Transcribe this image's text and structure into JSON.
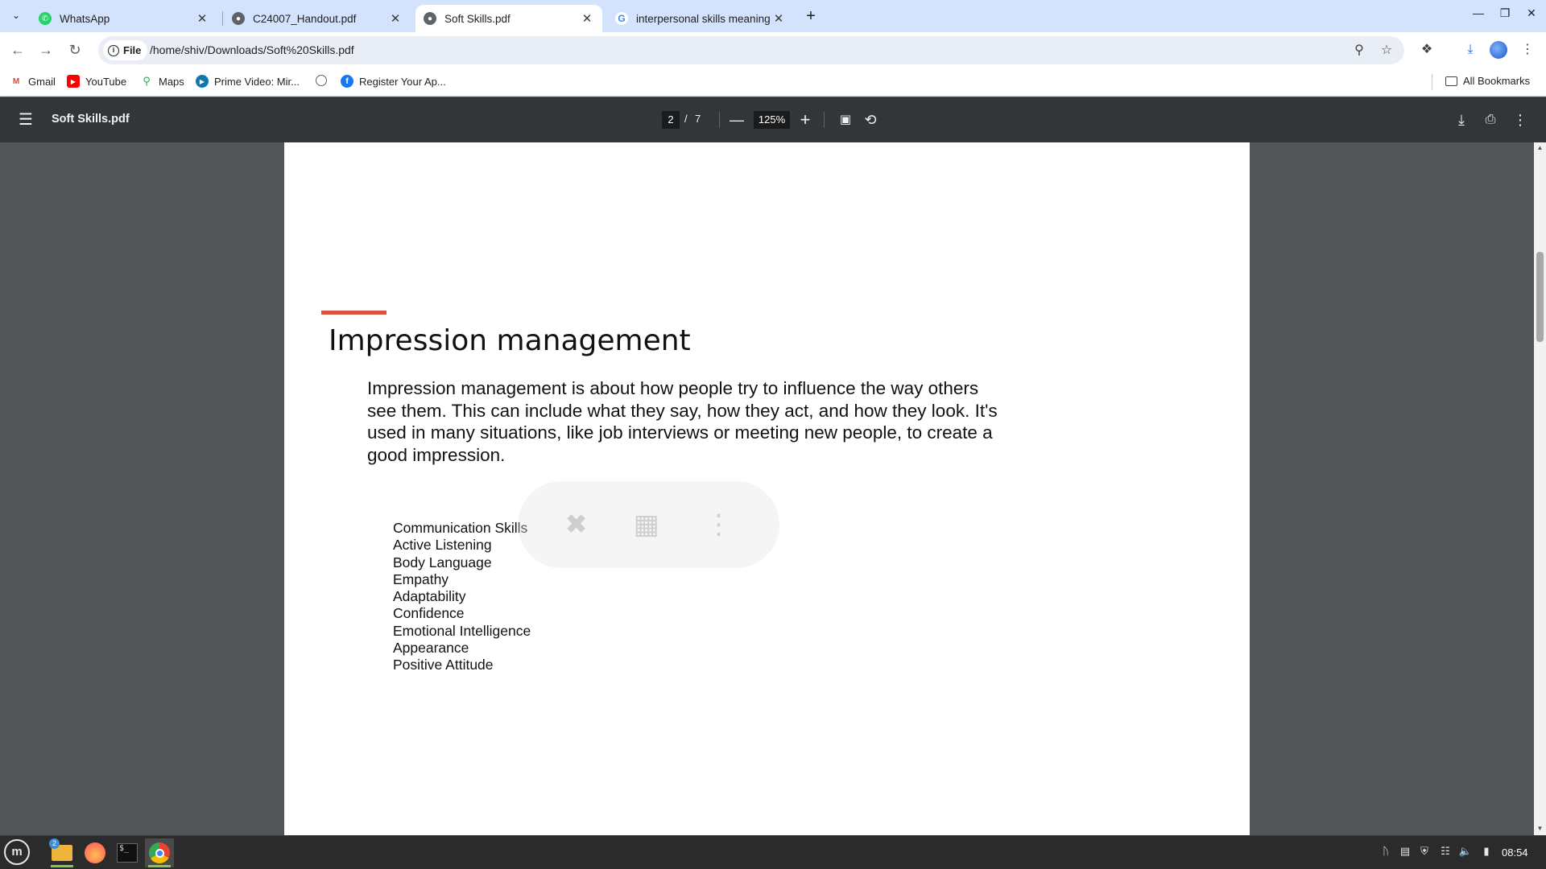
{
  "browser": {
    "tabs": [
      {
        "title": "WhatsApp",
        "active": false,
        "icon": "whatsapp-icon"
      },
      {
        "title": "C24007_Handout.pdf",
        "active": false,
        "icon": "globe-icon"
      },
      {
        "title": "Soft Skills.pdf",
        "active": true,
        "icon": "globe-icon"
      },
      {
        "title": "interpersonal skills meaning",
        "active": false,
        "icon": "google-icon"
      }
    ],
    "chip_label": "File",
    "url": "/home/shiv/Downloads/Soft%20Skills.pdf",
    "bookmarks": [
      {
        "label": "Gmail",
        "icon": "gmail-icon"
      },
      {
        "label": "YouTube",
        "icon": "youtube-icon"
      },
      {
        "label": "Maps",
        "icon": "maps-icon"
      },
      {
        "label": "Prime Video: Mir...",
        "icon": "prime-video-icon"
      },
      {
        "label": "",
        "icon": "globe-icon"
      },
      {
        "label": "Register Your Ap...",
        "icon": "facebook-icon"
      }
    ],
    "all_bookmarks_label": "All Bookmarks"
  },
  "pdf_viewer": {
    "title": "Soft Skills.pdf",
    "current_page": "2",
    "page_separator": "/",
    "total_pages": "7",
    "zoom": "125%"
  },
  "slide": {
    "title": "Impression management",
    "body": "Impression management is about how people try to influence the way others see them. This can include what they say, how they act, and how they look. It's used in many situations, like job interviews or meeting new people, to create a good impression.",
    "skills": [
      "Communication Skills",
      "Active Listening",
      "Body Language",
      "Empathy",
      "Adaptability",
      "Confidence",
      "Emotional Intelligence",
      "Appearance",
      "Positive Attitude"
    ]
  },
  "taskbar": {
    "files_badge": "2",
    "clock": "08:54"
  },
  "colors": {
    "tabstrip": "#d3e3fd",
    "pdf_toolbar": "#323639",
    "viewer_bg": "#525659",
    "slide_accent": "#d9543d",
    "taskbar": "#2b2b2b"
  }
}
